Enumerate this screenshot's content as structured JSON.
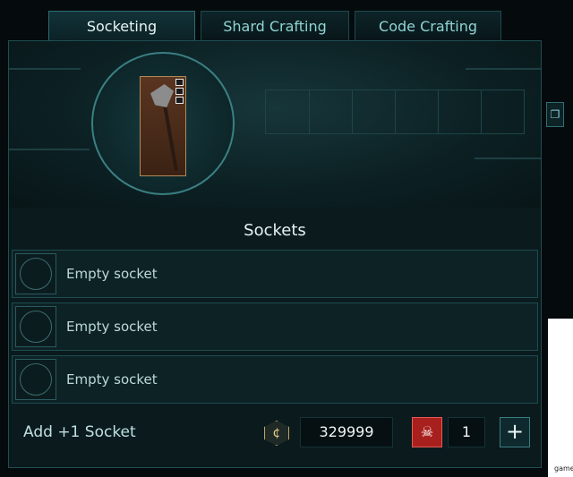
{
  "tabs": [
    {
      "label": "Socketing",
      "active": true
    },
    {
      "label": "Shard Crafting",
      "active": false
    },
    {
      "label": "Code Crafting",
      "active": false
    }
  ],
  "item": {
    "icon": "axe-icon"
  },
  "sockets_title": "Sockets",
  "sockets": [
    {
      "label": "Empty socket"
    },
    {
      "label": "Empty socket"
    },
    {
      "label": "Empty socket"
    }
  ],
  "footer": {
    "add_label": "Add +1 Socket",
    "credits_value": "329999",
    "token_value": "1",
    "plus_label": "+",
    "credit_icon": "credit-icon",
    "token_icon": "skull-token-icon"
  },
  "corner_text": "game",
  "colors": {
    "accent": "#3a7f83",
    "panel": "#0a1a1d",
    "token_red": "#a8201d"
  }
}
